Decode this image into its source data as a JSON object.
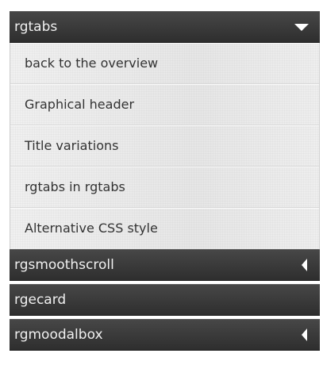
{
  "sections": [
    {
      "title": "rgtabs",
      "expanded": true,
      "arrow_icon": "arrow-down-icon",
      "items": [
        "back to the overview",
        "Graphical header",
        "Title variations",
        "rgtabs in rgtabs",
        "Alternative CSS style"
      ]
    },
    {
      "title": "rgsmoothscroll",
      "expanded": false,
      "arrow_icon": "arrow-left-icon"
    },
    {
      "title": "rgecard",
      "expanded": false,
      "arrow_icon": ""
    },
    {
      "title": "rgmoodalbox",
      "expanded": false,
      "arrow_icon": "arrow-left-icon"
    }
  ],
  "colors": {
    "header_bg": "#3a3a3a",
    "header_text": "#f0f0f0",
    "content_bg": "#eaeaea",
    "item_text": "#333333"
  }
}
